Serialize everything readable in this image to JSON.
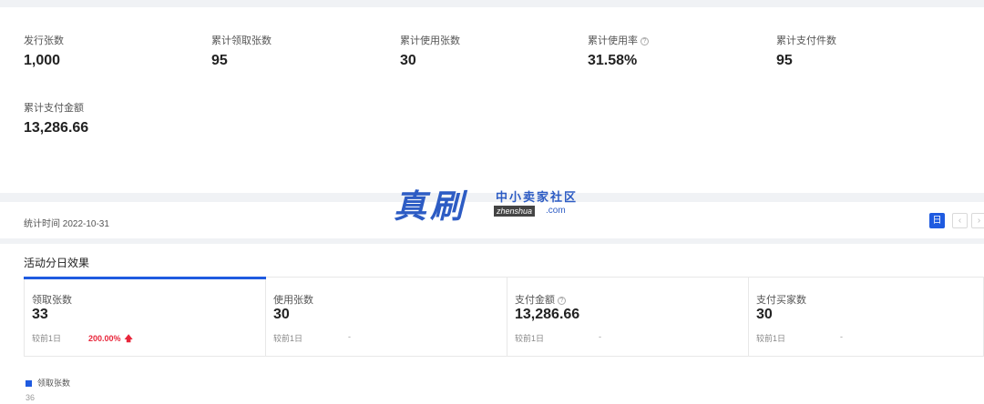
{
  "summary": {
    "metrics": [
      {
        "label": "发行张数",
        "value": "1,000",
        "help": false
      },
      {
        "label": "累计领取张数",
        "value": "95",
        "help": false
      },
      {
        "label": "累计使用张数",
        "value": "30",
        "help": false
      },
      {
        "label": "累计使用率",
        "value": "31.58%",
        "help": true
      },
      {
        "label": "累计支付件数",
        "value": "95",
        "help": false
      },
      {
        "label": "累计支付金额",
        "value": "13,286.66",
        "help": false
      }
    ]
  },
  "stat_bar": {
    "time_label": "统计时间 2022-10-31",
    "day_button": "日",
    "prev_icon": "chevron-left-icon",
    "next_icon": "chevron-right-icon"
  },
  "watermark": {
    "main": "真刷",
    "sub": "中小卖家社区",
    "tag": "zhenshua",
    "domain": ".com"
  },
  "daily": {
    "title": "活动分日效果",
    "kpis": [
      {
        "label": "领取张数",
        "value": "33",
        "compare_label": "较前1日",
        "change": "200.00%",
        "trend": "up",
        "active": true,
        "help": false
      },
      {
        "label": "使用张数",
        "value": "30",
        "compare_label": "较前1日",
        "change": "-",
        "trend": "none",
        "active": false,
        "help": false
      },
      {
        "label": "支付金额",
        "value": "13,286.66",
        "compare_label": "较前1日",
        "change": "-",
        "trend": "none",
        "active": false,
        "help": true
      },
      {
        "label": "支付买家数",
        "value": "30",
        "compare_label": "较前1日",
        "change": "-",
        "trend": "none",
        "active": false,
        "help": false
      }
    ],
    "legend_label": "领取张数",
    "legend_color": "#1f5be0",
    "y_axis_top_tick": "36"
  },
  "colors": {
    "accent": "#1f5be0",
    "increase": "#e8263b"
  }
}
